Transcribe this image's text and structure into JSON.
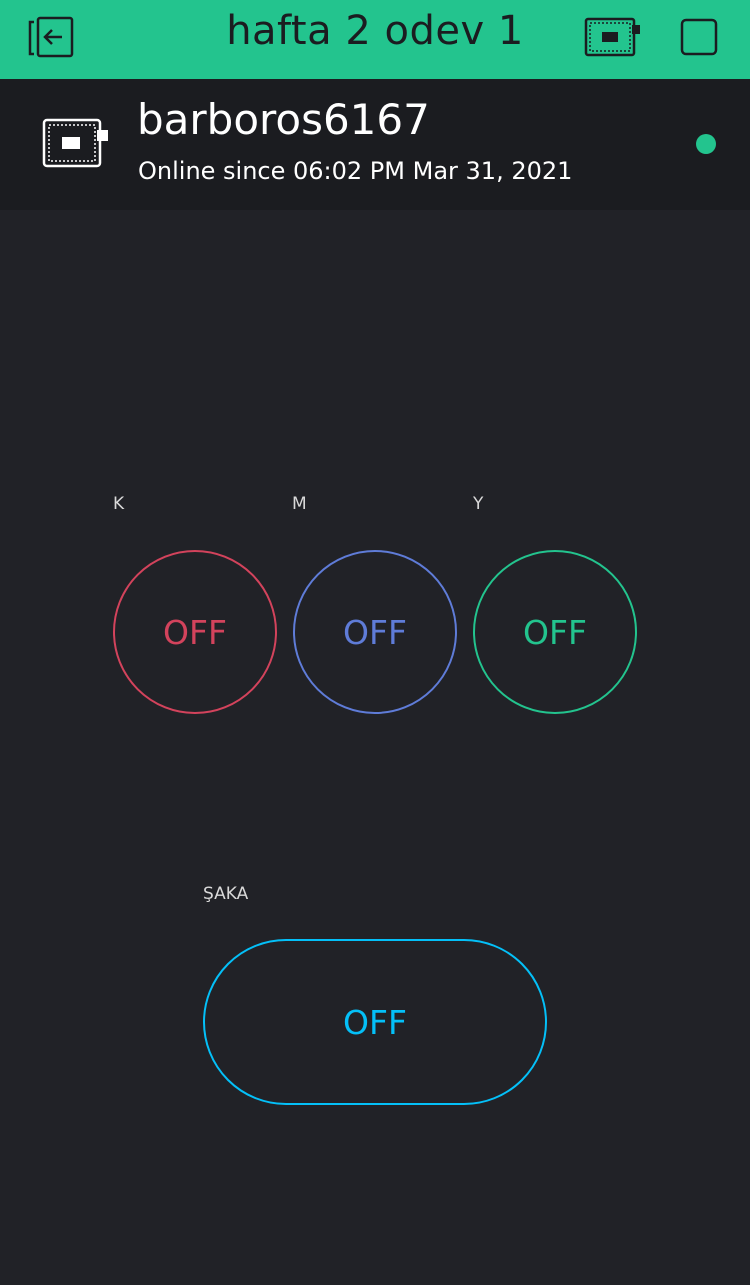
{
  "header": {
    "title": "hafta 2 odev 1",
    "icons": [
      "exit-icon",
      "device-icon",
      "square-icon"
    ]
  },
  "device": {
    "name": "barboros6167",
    "status": "Online since 06:02 PM Mar 31, 2021",
    "online": true,
    "online_color": "#23c48e"
  },
  "buttons": [
    {
      "label": "K",
      "state": "OFF",
      "color": "#d3435c"
    },
    {
      "label": "M",
      "state": "OFF",
      "color": "#5f7cd8"
    },
    {
      "label": "Y",
      "state": "OFF",
      "color": "#23c48e"
    }
  ],
  "joke_button": {
    "label": "ŞAKA",
    "state": "OFF",
    "color": "#04c0f8"
  },
  "colors": {
    "header_bg": "#23c48e",
    "background": "#212227",
    "device_bar_bg": "#1b1c20"
  }
}
